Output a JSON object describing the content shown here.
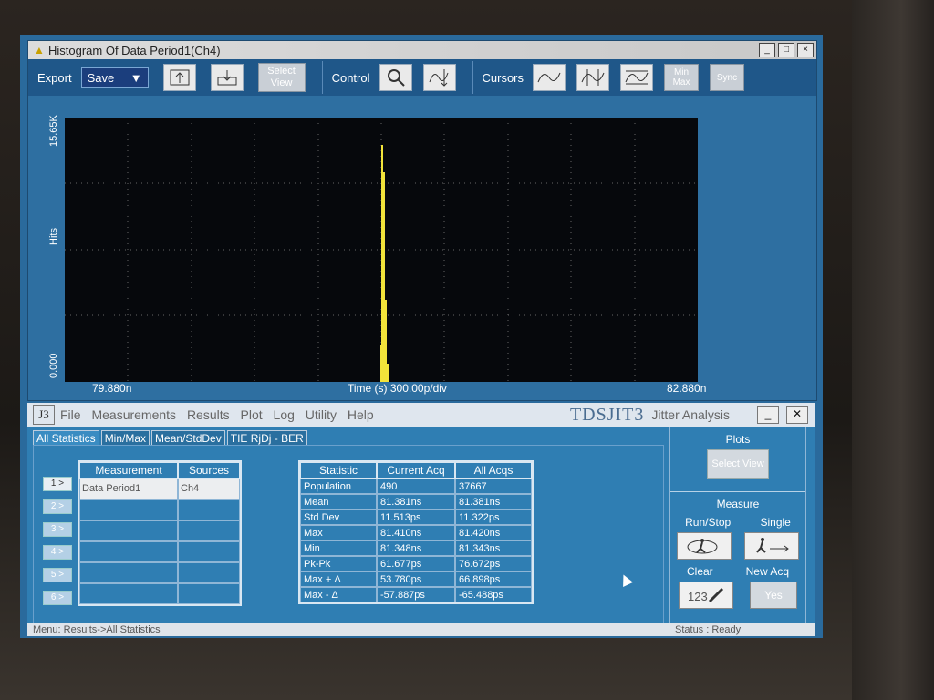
{
  "window": {
    "title": "Histogram Of Data Period1(Ch4)"
  },
  "toolbar": {
    "export_label": "Export",
    "save_label": "Save",
    "select_view_label": "Select View",
    "control_label": "Control",
    "cursors_label": "Cursors",
    "minmax_label": "Min Max",
    "sync_label": "Sync"
  },
  "plot": {
    "ymax": "15.65K",
    "ymin": "0.000",
    "ylabel": "Hits",
    "xmin": "79.880n",
    "xmax": "82.880n",
    "xlabel": "Time (s)  300.00p/div"
  },
  "jitter": {
    "logo": "J3",
    "menu": [
      "File",
      "Measurements",
      "Results",
      "Plot",
      "Log",
      "Utility",
      "Help"
    ],
    "brand": "TDSJIT3",
    "subtitle": "Jitter Analysis",
    "tabs": [
      "All Statistics",
      "Min/Max",
      "Mean/StdDev",
      "TIE RjDj - BER"
    ],
    "row_buttons": [
      "1 >",
      "2 >",
      "3 >",
      "4 >",
      "5 >",
      "6 >"
    ],
    "meas_headers": [
      "Measurement",
      "Sources"
    ],
    "meas_rows": [
      [
        "Data Period1",
        "Ch4"
      ],
      [
        "",
        ""
      ],
      [
        "",
        ""
      ],
      [
        "",
        ""
      ],
      [
        "",
        ""
      ],
      [
        "",
        ""
      ]
    ],
    "stat_headers": [
      "Statistic",
      "Current Acq",
      "All Acqs"
    ],
    "stats": [
      [
        "Population",
        "490",
        "37667"
      ],
      [
        "Mean",
        "81.381ns",
        "81.381ns"
      ],
      [
        "Std Dev",
        "11.513ps",
        "11.322ps"
      ],
      [
        "Max",
        "81.410ns",
        "81.420ns"
      ],
      [
        "Min",
        "81.348ns",
        "81.343ns"
      ],
      [
        "Pk-Pk",
        "61.677ps",
        "76.672ps"
      ],
      [
        "Max + Δ",
        "53.780ps",
        "66.898ps"
      ],
      [
        "Max - Δ",
        "-57.887ps",
        "-65.488ps"
      ]
    ],
    "side": {
      "plots": "Plots",
      "select_view": "Select View",
      "measure": "Measure",
      "run_stop": "Run/Stop",
      "single": "Single",
      "clear": "Clear",
      "new_acq": "New Acq",
      "yes": "Yes"
    },
    "status_left": "Menu: Results->All Statistics",
    "status_right": "Status : Ready"
  }
}
